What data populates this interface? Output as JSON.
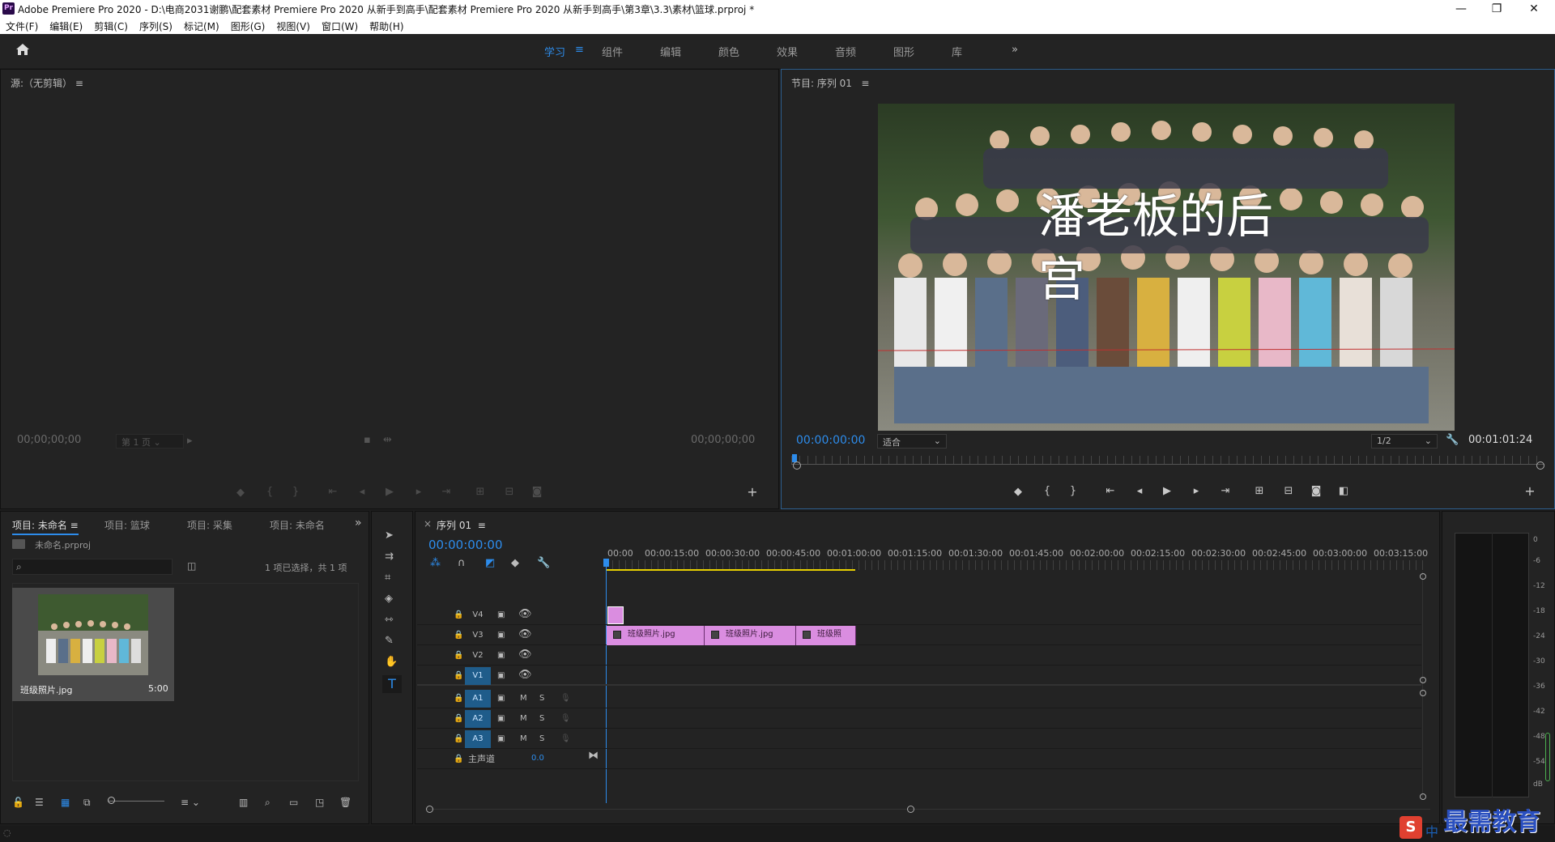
{
  "window": {
    "title": "Adobe Premiere Pro 2020 - D:\\电商2031谢鹏\\配套素材 Premiere Pro 2020 从新手到高手\\配套素材 Premiere Pro 2020 从新手到高手\\第3章\\3.3\\素材\\篮球.prproj *",
    "logo_text": "Pr",
    "minimize": "—",
    "maximize": "❐",
    "close": "✕"
  },
  "menu": [
    "文件(F)",
    "编辑(E)",
    "剪辑(C)",
    "序列(S)",
    "标记(M)",
    "图形(G)",
    "视图(V)",
    "窗口(W)",
    "帮助(H)"
  ],
  "workspaces": {
    "items": [
      "学习",
      "组件",
      "编辑",
      "颜色",
      "效果",
      "音频",
      "图形",
      "库"
    ],
    "active_index": 0,
    "menu_glyph": "≡",
    "more_glyph": "»"
  },
  "source_monitor": {
    "title": "源:（无剪辑）",
    "menu_glyph": "≡",
    "timecode_in": "00;00;00;00",
    "timecode_out": "00;00;00;00",
    "page_select": "第 1 页"
  },
  "program_monitor": {
    "title": "节目: 序列 01",
    "menu_glyph": "≡",
    "timecode_current": "00:00:00:00",
    "timecode_duration": "00:01:01:24",
    "fit_select": "适合",
    "resolution_select": "1/2",
    "overlay_title_line1": "潘老板的后",
    "overlay_title_line2": "宫"
  },
  "project_panel": {
    "tabs": [
      "项目: 未命名",
      "项目: 篮球",
      "项目: 采集",
      "项目: 未命名"
    ],
    "active_tab": 0,
    "file_name": "未命名.prproj",
    "selection_status": "1 项已选择，共 1 项",
    "item_name": "班级照片.jpg",
    "item_duration": "5:00"
  },
  "timeline": {
    "tab_title": "序列 01",
    "menu_glyph": "≡",
    "close_glyph": "×",
    "timecode": "00:00:00:00",
    "ruler": [
      "00:00",
      "00:00:15:00",
      "00:00:30:00",
      "00:00:45:00",
      "00:01:00:00",
      "00:01:15:00",
      "00:01:30:00",
      "00:01:45:00",
      "00:02:00:00",
      "00:02:15:00",
      "00:02:30:00",
      "00:02:45:00",
      "00:03:00:00",
      "00:03:15:00"
    ],
    "video_tracks": [
      "V4",
      "V3",
      "V2",
      "V1"
    ],
    "audio_tracks": [
      "A1",
      "A2",
      "A3"
    ],
    "master_label": "主声道",
    "master_value": "0.0",
    "clips": [
      {
        "track": "V3",
        "label": "班级照片.jpg"
      },
      {
        "track": "V3",
        "label": "班级照片.jpg"
      },
      {
        "track": "V3",
        "label": "班级照"
      }
    ],
    "mute_label": "M",
    "solo_label": "S"
  },
  "audio_meter": {
    "scale": [
      "0",
      "-6",
      "-12",
      "-18",
      "-24",
      "-30",
      "-36",
      "-42",
      "-48",
      "-54",
      "dB"
    ]
  },
  "watermark": {
    "text": "最需教育",
    "ime_text": "中"
  }
}
